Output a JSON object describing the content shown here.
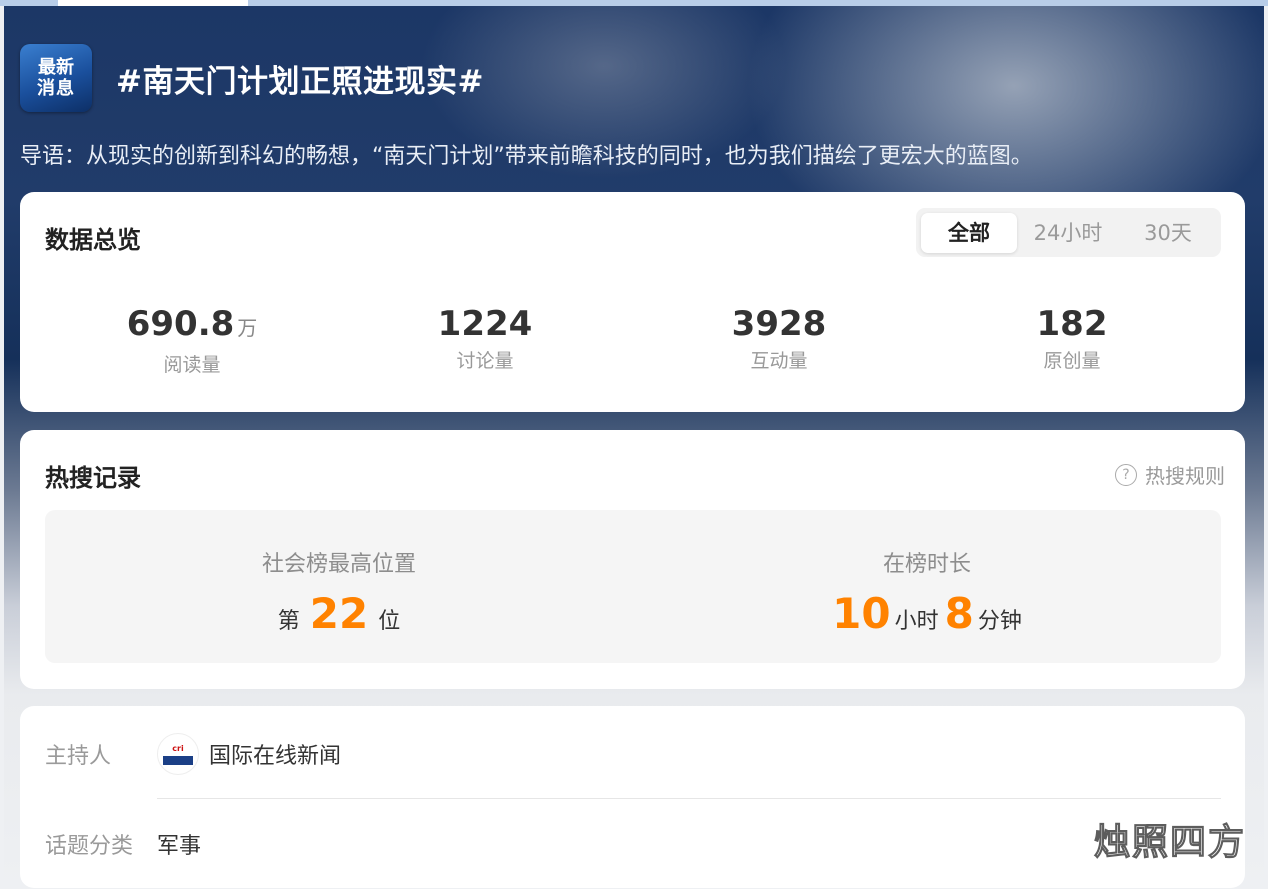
{
  "header": {
    "logo": {
      "line1": "最新",
      "line2": "消息"
    },
    "title": "#南天门计划正照进现实#",
    "intro": "导语：从现实的创新到科幻的畅想，“南天门计划”带来前瞻科技的同时，也为我们描绘了更宏大的蓝图。"
  },
  "overview": {
    "title": "数据总览",
    "tabs": [
      {
        "label": "全部",
        "active": true
      },
      {
        "label": "24小时",
        "active": false
      },
      {
        "label": "30天",
        "active": false
      }
    ],
    "stats": [
      {
        "value": "690.8",
        "unit": "万",
        "label": "阅读量"
      },
      {
        "value": "1224",
        "unit": "",
        "label": "讨论量"
      },
      {
        "value": "3928",
        "unit": "",
        "label": "互动量"
      },
      {
        "value": "182",
        "unit": "",
        "label": "原创量"
      }
    ]
  },
  "hot": {
    "title": "热搜记录",
    "rules_label": "热搜规则",
    "rank": {
      "label": "社会榜最高位置",
      "prefix": "第",
      "value": "22",
      "suffix": "位"
    },
    "duration": {
      "label": "在榜时长",
      "hours": "10",
      "hours_unit": "小时",
      "minutes": "8",
      "minutes_unit": "分钟"
    }
  },
  "info": {
    "host_label": "主持人",
    "host_name": "国际在线新闻",
    "category_label": "话题分类",
    "category_value": "军事"
  },
  "watermark": "烛照四方",
  "colors": {
    "accent": "#ff8200",
    "hero_dark": "#1c3766"
  }
}
